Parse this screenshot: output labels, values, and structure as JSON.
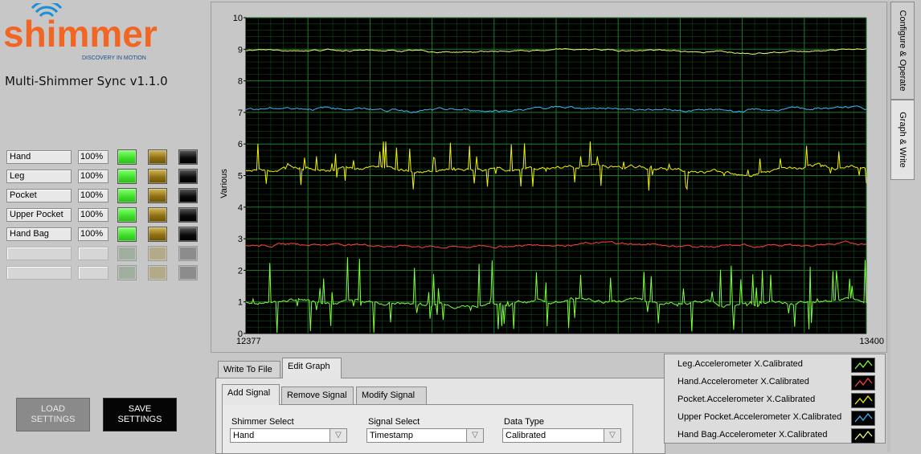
{
  "app": {
    "logo_text": "shimmer",
    "logo_tagline": "DISCOVERY IN MOTION",
    "title": "Multi-Shimmer Sync v1.1.0"
  },
  "devices": [
    {
      "name": "Hand",
      "percent": "100%",
      "enabled": true
    },
    {
      "name": "Leg",
      "percent": "100%",
      "enabled": true
    },
    {
      "name": "Pocket",
      "percent": "100%",
      "enabled": true
    },
    {
      "name": "Upper Pocket",
      "percent": "100%",
      "enabled": true
    },
    {
      "name": "Hand Bag",
      "percent": "100%",
      "enabled": true
    },
    {
      "name": "",
      "percent": "",
      "enabled": false
    },
    {
      "name": "",
      "percent": "",
      "enabled": false
    }
  ],
  "buttons": {
    "load": "LOAD SETTINGS",
    "save": "SAVE SETTINGS"
  },
  "side_tabs": {
    "configure": "Configure & Operate",
    "graph": "Graph & Write"
  },
  "tabs": {
    "write_to_file": "Write To File",
    "edit_graph": "Edit Graph",
    "add_signal": "Add Signal",
    "remove_signal": "Remove Signal",
    "modify_signal": "Modify Signal"
  },
  "form": {
    "shimmer_select_label": "Shimmer Select",
    "shimmer_select_value": "Hand",
    "signal_select_label": "Signal Select",
    "signal_select_value": "Timestamp",
    "data_type_label": "Data Type",
    "data_type_value": "Calibrated"
  },
  "colors": {
    "plot_bg": "#000000",
    "grid": "#1f7a2a",
    "accent_logo": "#f26522"
  },
  "chart_data": {
    "type": "line",
    "ylabel": "Various",
    "xlim": [
      12377,
      13400
    ],
    "ylim": [
      0,
      10
    ],
    "x_tick_labels": [
      "12377",
      "13400"
    ],
    "y_ticks": [
      0,
      1,
      2,
      3,
      4,
      5,
      6,
      7,
      8,
      9,
      10
    ],
    "grid": true,
    "legend_position": "bottom-right",
    "series": [
      {
        "name": "Leg.Accelerometer X.Calibrated",
        "color": "#7fff3a",
        "baseline": 1.0,
        "noise": 0.12,
        "spikes": true
      },
      {
        "name": "Hand.Accelerometer X.Calibrated",
        "color": "#ff4040",
        "baseline": 2.8,
        "noise": 0.08,
        "spikes": false
      },
      {
        "name": "Pocket.Accelerometer X.Calibrated",
        "color": "#f2f200",
        "baseline": 5.2,
        "noise": 0.12,
        "spikes": true
      },
      {
        "name": "Upper Pocket.Accelerometer X.Calibrated",
        "color": "#3fb5ff",
        "baseline": 7.1,
        "noise": 0.08,
        "spikes": false
      },
      {
        "name": "Hand Bag.Accelerometer X.Calibrated",
        "color": "#e8ff70",
        "baseline": 8.95,
        "noise": 0.05,
        "spikes": false
      }
    ]
  }
}
